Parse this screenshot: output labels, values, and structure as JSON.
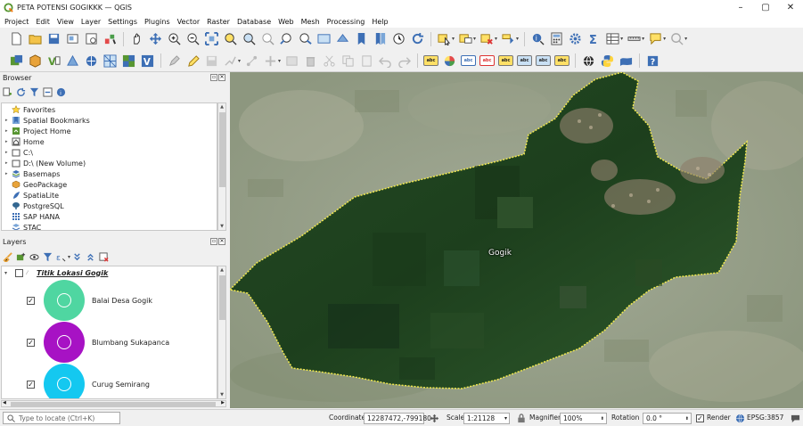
{
  "window": {
    "title": "PETA POTENSI GOGIKKK — QGIS",
    "minimize": "–",
    "maximize": "▢",
    "close": "✕"
  },
  "menu": [
    "Project",
    "Edit",
    "View",
    "Layer",
    "Settings",
    "Plugins",
    "Vector",
    "Raster",
    "Database",
    "Web",
    "Mesh",
    "Processing",
    "Help"
  ],
  "colors": {
    "accent_green": "#589632",
    "map_outline": "#f2e94e"
  },
  "browser": {
    "title": "Browser",
    "items": [
      {
        "label": "Favorites",
        "icon": "star-icon",
        "expand": ""
      },
      {
        "label": "Spatial Bookmarks",
        "icon": "bookmark-icon",
        "expand": "▸"
      },
      {
        "label": "Project Home",
        "icon": "project-home-icon",
        "expand": "▸"
      },
      {
        "label": "Home",
        "icon": "home-folder-icon",
        "expand": "▸"
      },
      {
        "label": "C:\\",
        "icon": "drive-icon",
        "expand": "▸"
      },
      {
        "label": "D:\\ (New Volume)",
        "icon": "drive-icon",
        "expand": "▸"
      },
      {
        "label": "Basemaps",
        "icon": "basemaps-icon",
        "expand": "▸"
      },
      {
        "label": "GeoPackage",
        "icon": "geopackage-icon",
        "expand": ""
      },
      {
        "label": "SpatiaLite",
        "icon": "spatialite-icon",
        "expand": ""
      },
      {
        "label": "PostgreSQL",
        "icon": "postgresql-icon",
        "expand": ""
      },
      {
        "label": "SAP HANA",
        "icon": "sap-hana-icon",
        "expand": ""
      },
      {
        "label": "STAC",
        "icon": "stac-icon",
        "expand": ""
      }
    ]
  },
  "layers": {
    "title": "Layers",
    "group": {
      "name": "Titik Lokasi Gogik",
      "expand": "▾"
    },
    "items": [
      {
        "label": "Balai Desa Gogik",
        "color": "#4fd6a1",
        "checked": "✓"
      },
      {
        "label": "Blumbang Sukapanca",
        "color": "#a712c4",
        "checked": "✓"
      },
      {
        "label": "Curug Semirang",
        "color": "#14c8f0",
        "checked": "✓"
      }
    ]
  },
  "map": {
    "feature_label": "Gogik"
  },
  "status": {
    "locate_placeholder": "Type to locate (Ctrl+K)",
    "coordinate_label": "Coordinate",
    "coordinate_value": "12287472,-799180",
    "scale_label": "Scale",
    "scale_value": "1:21128",
    "magnifier_label": "Magnifier",
    "magnifier_value": "100%",
    "rotation_label": "Rotation",
    "rotation_value": "0.0 °",
    "render_label": "Render",
    "render_checked": "✓",
    "crs": "EPSG:3857"
  }
}
